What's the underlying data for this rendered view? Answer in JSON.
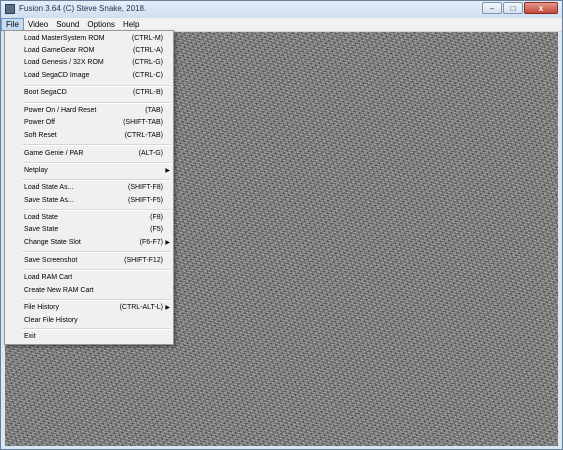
{
  "window": {
    "title": "Fusion 3.64 (C) Steve Snake, 2018.",
    "controls": {
      "minimize": "–",
      "maximize": "□",
      "close": "x"
    }
  },
  "menubar": {
    "items": [
      "File",
      "Video",
      "Sound",
      "Options",
      "Help"
    ]
  },
  "file_menu": {
    "items": [
      {
        "label": "Load MasterSystem ROM",
        "shortcut": "(CTRL-M)"
      },
      {
        "label": "Load GameGear ROM",
        "shortcut": "(CTRL-A)"
      },
      {
        "label": "Load Genesis / 32X ROM",
        "shortcut": "(CTRL-G)"
      },
      {
        "label": "Load SegaCD Image",
        "shortcut": "(CTRL-C)"
      },
      {
        "label": "Boot SegaCD",
        "shortcut": "(CTRL-B)"
      },
      {
        "label": "Power On / Hard Reset",
        "shortcut": "(TAB)"
      },
      {
        "label": "Power Off",
        "shortcut": "(SHIFT-TAB)"
      },
      {
        "label": "Soft Reset",
        "shortcut": "(CTRL-TAB)"
      },
      {
        "label": "Game Genie / PAR",
        "shortcut": "(ALT-G)"
      },
      {
        "label": "Netplay",
        "shortcut": ""
      },
      {
        "label": "Load State As...",
        "shortcut": "(SHIFT-F8)"
      },
      {
        "label": "Save State As...",
        "shortcut": "(SHIFT-F5)"
      },
      {
        "label": "Load State",
        "shortcut": "(F8)"
      },
      {
        "label": "Save State",
        "shortcut": "(F5)"
      },
      {
        "label": "Change State Slot",
        "shortcut": "(F6-F7)"
      },
      {
        "label": "Save Screenshot",
        "shortcut": "(SHIFT-F12)"
      },
      {
        "label": "Load RAM Cart",
        "shortcut": ""
      },
      {
        "label": "Create New RAM Cart",
        "shortcut": ""
      },
      {
        "label": "File History",
        "shortcut": "(CTRL-ALT-L)"
      },
      {
        "label": "Clear File History",
        "shortcut": ""
      },
      {
        "label": "Exit",
        "shortcut": ""
      }
    ]
  }
}
